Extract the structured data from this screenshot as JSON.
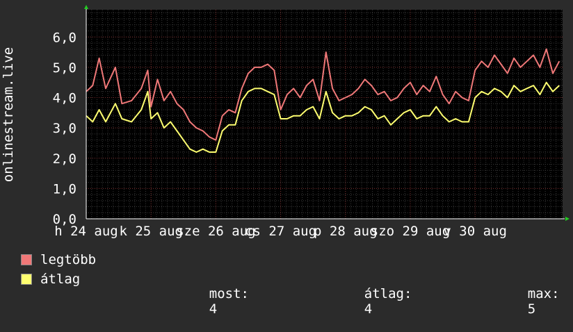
{
  "chart_data": {
    "type": "line",
    "ylabel": "onlinestream.live",
    "ylim": [
      0,
      6.9
    ],
    "yticks": [
      "0,0",
      "1,0",
      "2,0",
      "3,0",
      "4,0",
      "5,0",
      "6,0"
    ],
    "xlim": [
      0,
      7.35
    ],
    "xticks": [
      {
        "at": 0,
        "label": "h 24 aug"
      },
      {
        "at": 1,
        "label": "k 25 aug"
      },
      {
        "at": 2,
        "label": "sze 26 aug"
      },
      {
        "at": 3,
        "label": "cs 27 aug"
      },
      {
        "at": 4,
        "label": "p 28 aug"
      },
      {
        "at": 5,
        "label": "szo 29 aug"
      },
      {
        "at": 6,
        "label": "v 30 aug"
      }
    ],
    "x_unit": "days since Mon 24 Aug",
    "grid": true,
    "background": "#000000",
    "series": [
      {
        "name": "legtöbb",
        "color": "#f07878",
        "points": [
          [
            0,
            4.2
          ],
          [
            0.1,
            4.4
          ],
          [
            0.2,
            5.3
          ],
          [
            0.3,
            4.3
          ],
          [
            0.45,
            5.0
          ],
          [
            0.55,
            3.8
          ],
          [
            0.7,
            3.9
          ],
          [
            0.85,
            4.3
          ],
          [
            0.95,
            4.9
          ],
          [
            1.0,
            3.7
          ],
          [
            1.1,
            4.6
          ],
          [
            1.2,
            3.9
          ],
          [
            1.3,
            4.2
          ],
          [
            1.4,
            3.8
          ],
          [
            1.5,
            3.6
          ],
          [
            1.6,
            3.2
          ],
          [
            1.7,
            3.0
          ],
          [
            1.8,
            2.9
          ],
          [
            1.9,
            2.7
          ],
          [
            2.0,
            2.6
          ],
          [
            2.1,
            3.4
          ],
          [
            2.2,
            3.6
          ],
          [
            2.3,
            3.5
          ],
          [
            2.4,
            4.3
          ],
          [
            2.5,
            4.8
          ],
          [
            2.6,
            5.0
          ],
          [
            2.7,
            5.0
          ],
          [
            2.8,
            5.1
          ],
          [
            2.9,
            4.9
          ],
          [
            3.0,
            3.6
          ],
          [
            3.1,
            4.1
          ],
          [
            3.2,
            4.3
          ],
          [
            3.3,
            4.0
          ],
          [
            3.4,
            4.4
          ],
          [
            3.5,
            4.6
          ],
          [
            3.6,
            3.9
          ],
          [
            3.7,
            5.5
          ],
          [
            3.8,
            4.3
          ],
          [
            3.9,
            3.9
          ],
          [
            4.0,
            4.0
          ],
          [
            4.1,
            4.1
          ],
          [
            4.2,
            4.3
          ],
          [
            4.3,
            4.6
          ],
          [
            4.4,
            4.4
          ],
          [
            4.5,
            4.1
          ],
          [
            4.6,
            4.2
          ],
          [
            4.7,
            3.9
          ],
          [
            4.8,
            4.0
          ],
          [
            4.9,
            4.3
          ],
          [
            5.0,
            4.5
          ],
          [
            5.1,
            4.1
          ],
          [
            5.2,
            4.4
          ],
          [
            5.3,
            4.2
          ],
          [
            5.4,
            4.7
          ],
          [
            5.5,
            4.1
          ],
          [
            5.6,
            3.8
          ],
          [
            5.7,
            4.2
          ],
          [
            5.8,
            4.0
          ],
          [
            5.9,
            3.9
          ],
          [
            6.0,
            4.9
          ],
          [
            6.1,
            5.2
          ],
          [
            6.2,
            5.0
          ],
          [
            6.3,
            5.4
          ],
          [
            6.4,
            5.1
          ],
          [
            6.5,
            4.8
          ],
          [
            6.6,
            5.3
          ],
          [
            6.7,
            5.0
          ],
          [
            6.8,
            5.2
          ],
          [
            6.9,
            5.4
          ],
          [
            7.0,
            5.0
          ],
          [
            7.1,
            5.6
          ],
          [
            7.2,
            4.8
          ],
          [
            7.3,
            5.2
          ]
        ]
      },
      {
        "name": "átlag",
        "color": "#ffff70",
        "points": [
          [
            0,
            3.4
          ],
          [
            0.1,
            3.2
          ],
          [
            0.2,
            3.6
          ],
          [
            0.3,
            3.2
          ],
          [
            0.45,
            3.8
          ],
          [
            0.55,
            3.3
          ],
          [
            0.7,
            3.2
          ],
          [
            0.85,
            3.6
          ],
          [
            0.95,
            4.2
          ],
          [
            1.0,
            3.3
          ],
          [
            1.1,
            3.5
          ],
          [
            1.2,
            3.0
          ],
          [
            1.3,
            3.2
          ],
          [
            1.4,
            2.9
          ],
          [
            1.5,
            2.6
          ],
          [
            1.6,
            2.3
          ],
          [
            1.7,
            2.2
          ],
          [
            1.8,
            2.3
          ],
          [
            1.9,
            2.2
          ],
          [
            2.0,
            2.2
          ],
          [
            2.1,
            2.9
          ],
          [
            2.2,
            3.1
          ],
          [
            2.3,
            3.1
          ],
          [
            2.4,
            3.9
          ],
          [
            2.5,
            4.2
          ],
          [
            2.6,
            4.3
          ],
          [
            2.7,
            4.3
          ],
          [
            2.8,
            4.2
          ],
          [
            2.9,
            4.1
          ],
          [
            3.0,
            3.3
          ],
          [
            3.1,
            3.3
          ],
          [
            3.2,
            3.4
          ],
          [
            3.3,
            3.4
          ],
          [
            3.4,
            3.6
          ],
          [
            3.5,
            3.7
          ],
          [
            3.6,
            3.3
          ],
          [
            3.7,
            4.2
          ],
          [
            3.8,
            3.5
          ],
          [
            3.9,
            3.3
          ],
          [
            4.0,
            3.4
          ],
          [
            4.1,
            3.4
          ],
          [
            4.2,
            3.5
          ],
          [
            4.3,
            3.7
          ],
          [
            4.4,
            3.6
          ],
          [
            4.5,
            3.3
          ],
          [
            4.6,
            3.4
          ],
          [
            4.7,
            3.1
          ],
          [
            4.8,
            3.3
          ],
          [
            4.9,
            3.5
          ],
          [
            5.0,
            3.6
          ],
          [
            5.1,
            3.3
          ],
          [
            5.2,
            3.4
          ],
          [
            5.3,
            3.4
          ],
          [
            5.4,
            3.7
          ],
          [
            5.5,
            3.4
          ],
          [
            5.6,
            3.2
          ],
          [
            5.7,
            3.3
          ],
          [
            5.8,
            3.2
          ],
          [
            5.9,
            3.2
          ],
          [
            6.0,
            4.0
          ],
          [
            6.1,
            4.2
          ],
          [
            6.2,
            4.1
          ],
          [
            6.3,
            4.3
          ],
          [
            6.4,
            4.2
          ],
          [
            6.5,
            4.0
          ],
          [
            6.6,
            4.4
          ],
          [
            6.7,
            4.2
          ],
          [
            6.8,
            4.3
          ],
          [
            6.9,
            4.4
          ],
          [
            7.0,
            4.1
          ],
          [
            7.1,
            4.5
          ],
          [
            7.2,
            4.2
          ],
          [
            7.3,
            4.4
          ]
        ]
      }
    ],
    "stats": {
      "most_label": "most:",
      "most_value": "4",
      "atlag_label": "átlag:",
      "atlag_value": "4",
      "max_label": "max:",
      "max_value": "5"
    }
  }
}
